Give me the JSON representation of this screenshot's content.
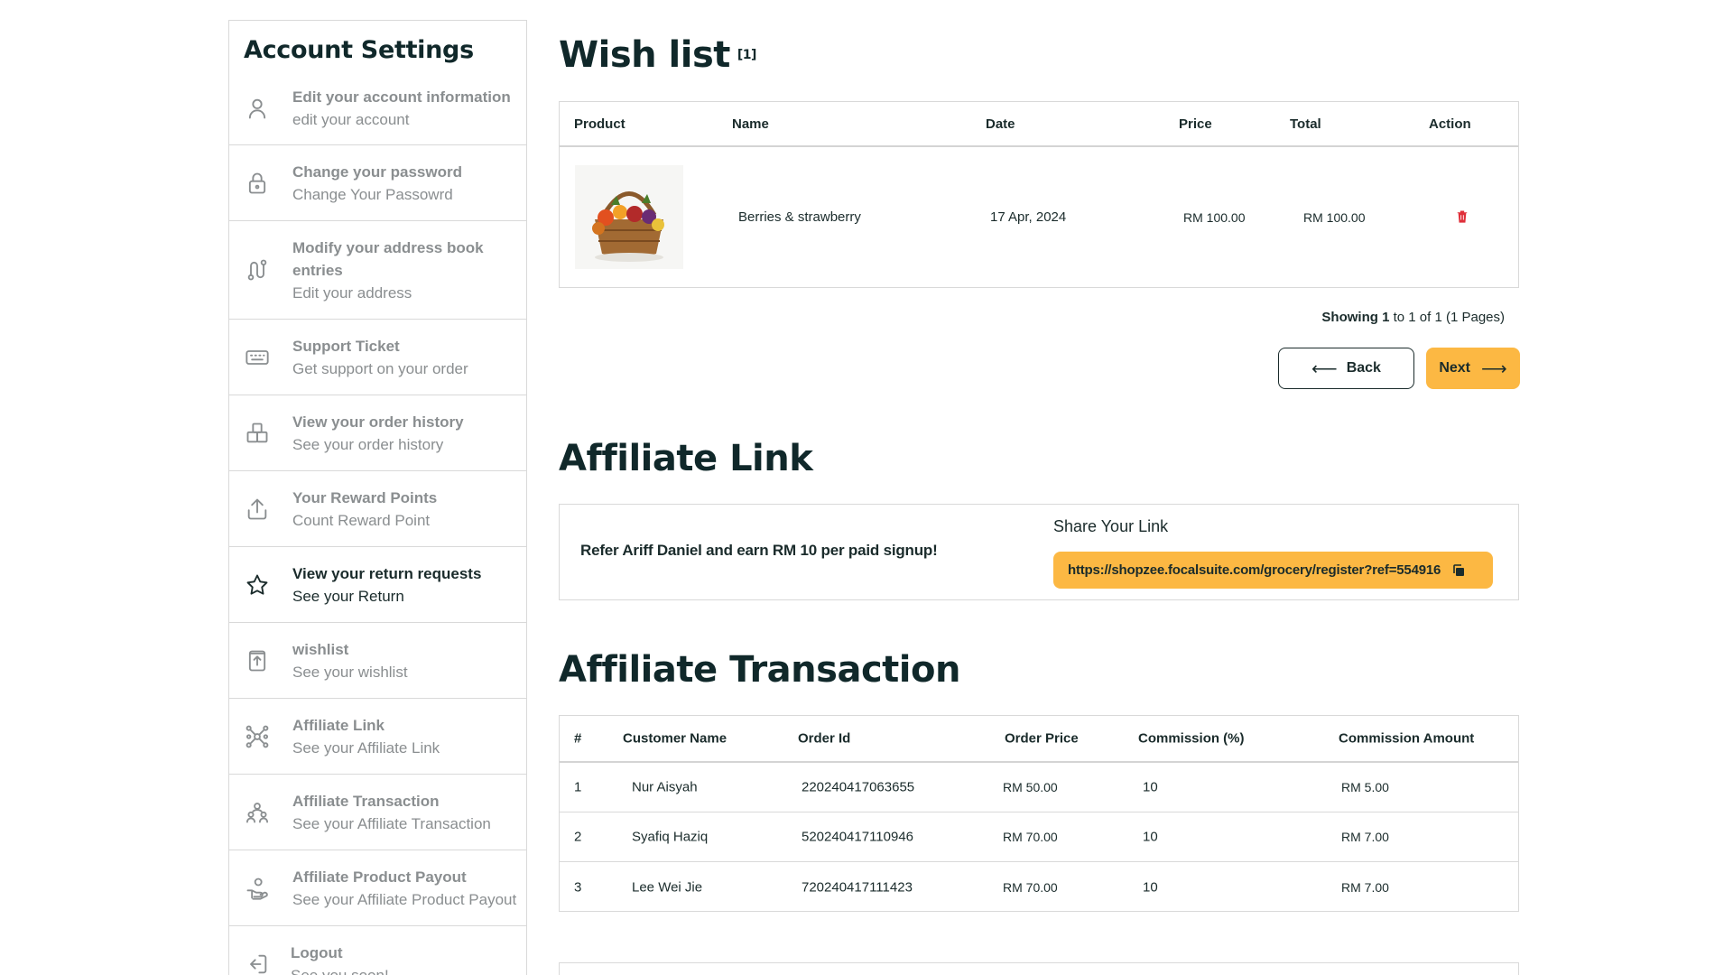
{
  "sidebar": {
    "title": "Account Settings",
    "items": [
      {
        "title": "Edit your account information",
        "subtitle": "edit your account",
        "icon": "user-icon"
      },
      {
        "title": "Change your password",
        "subtitle": "Change Your Passowrd",
        "icon": "lock-icon"
      },
      {
        "title": "Modify your address book entries",
        "subtitle": "Edit your address",
        "icon": "route-icon"
      },
      {
        "title": "Support Ticket",
        "subtitle": "Get support on your order",
        "icon": "keyboard-icon"
      },
      {
        "title": "View your order history",
        "subtitle": "See your order history",
        "icon": "box-stack-icon"
      },
      {
        "title": "Your Reward Points",
        "subtitle": "Count Reward Point",
        "icon": "share-icon"
      },
      {
        "title": "View your return requests",
        "subtitle": "See your Return",
        "icon": "star-icon"
      },
      {
        "title": "wishlist",
        "subtitle": "See your wishlist",
        "icon": "upload-box-icon"
      },
      {
        "title": "Affiliate Link",
        "subtitle": "See your Affiliate Link",
        "icon": "network-icon"
      },
      {
        "title": "Affiliate Transaction",
        "subtitle": "See your Affiliate Transaction",
        "icon": "users-group-icon"
      },
      {
        "title": "Affiliate Product Payout",
        "subtitle": "See your Affiliate Product Payout",
        "icon": "hand-coin-icon"
      },
      {
        "title": "Logout",
        "subtitle": "See you soon!",
        "icon": "logout-icon"
      }
    ]
  },
  "wishlist": {
    "title": "Wish list",
    "count": "[1]",
    "headers": {
      "product": "Product",
      "name": "Name",
      "date": "Date",
      "price": "Price",
      "total": "Total",
      "action": "Action"
    },
    "rows": [
      {
        "name": "Berries & strawberry",
        "date": "17 Apr, 2024",
        "price": "RM 100.00",
        "total": "RM 100.00"
      }
    ],
    "pager": {
      "showing": "Showing",
      "from": "1",
      "to_text": "to 1 of 1 (1 Pages)"
    },
    "back_label": "Back",
    "next_label": "Next"
  },
  "affiliate_link": {
    "title": "Affiliate Link",
    "refer_text": "Refer Ariff Daniel and earn RM 10 per paid signup!",
    "share_label": "Share Your Link",
    "url": "https://shopzee.focalsuite.com/grocery/register?ref=554916"
  },
  "affiliate_transaction": {
    "title": "Affiliate Transaction",
    "headers": {
      "num": "#",
      "customer": "Customer Name",
      "order_id": "Order Id",
      "order_price": "Order Price",
      "commission": "Commission (%)",
      "amount": "Commission Amount"
    },
    "rows": [
      {
        "num": "1",
        "customer": "Nur Aisyah",
        "order_id": "220240417063655",
        "order_price": "RM 50.00",
        "commission": "10",
        "amount": "RM 5.00"
      },
      {
        "num": "2",
        "customer": "Syafiq Haziq",
        "order_id": "520240417110946",
        "order_price": "RM 70.00",
        "commission": "10",
        "amount": "RM 7.00"
      },
      {
        "num": "3",
        "customer": "Lee Wei Jie",
        "order_id": "720240417111423",
        "order_price": "RM 70.00",
        "commission": "10",
        "amount": "RM 7.00"
      }
    ]
  },
  "colors": {
    "accent": "#fcb843",
    "text": "#1a2b2b",
    "muted": "#8a8e90",
    "danger": "#e0303b"
  }
}
